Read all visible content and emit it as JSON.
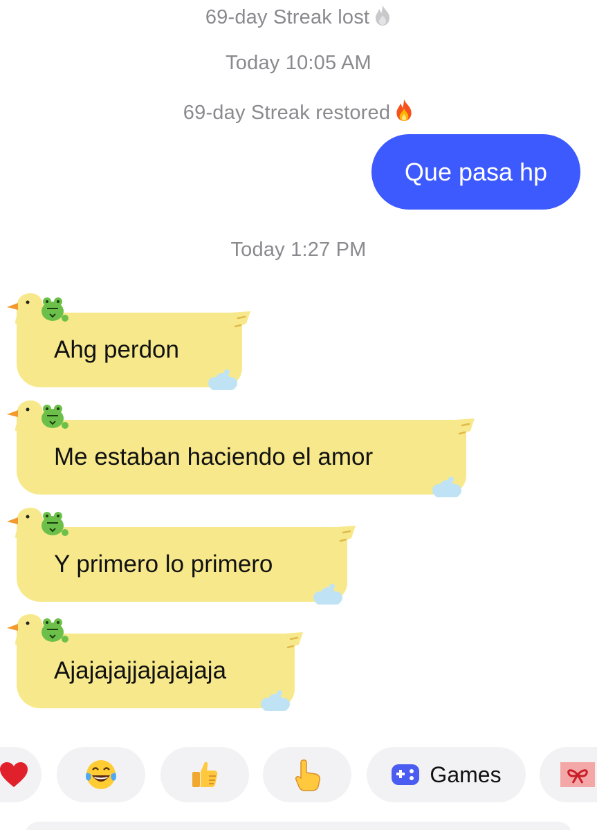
{
  "system_messages": {
    "streak_lost": "69-day Streak lost",
    "timestamp_1": "Today 10:05 AM",
    "streak_restored": "69-day Streak restored",
    "timestamp_2": "Today 1:27 PM"
  },
  "sent_messages": [
    {
      "text": "Que pasa hp"
    }
  ],
  "received_messages": [
    {
      "text": "Ahg perdon"
    },
    {
      "text": "Me estaban haciendo el amor"
    },
    {
      "text": "Y primero lo primero"
    },
    {
      "text": "Ajajajajjajajajaja"
    }
  ],
  "quick_replies": [
    {
      "icon": "red-heart-icon"
    },
    {
      "icon": "tears-of-joy-face-icon"
    },
    {
      "icon": "thumbs-up-icon"
    },
    {
      "icon": "pointing-finger-icon"
    },
    {
      "icon": "gamepad-icon",
      "label": "Games"
    },
    {
      "icon": "gift-icon"
    }
  ],
  "colors": {
    "sent_bubble": "#3d5afe",
    "duck_bubble": "#f7e98b",
    "system_text": "#8a8a8e",
    "chip_bg": "#f2f2f4"
  }
}
